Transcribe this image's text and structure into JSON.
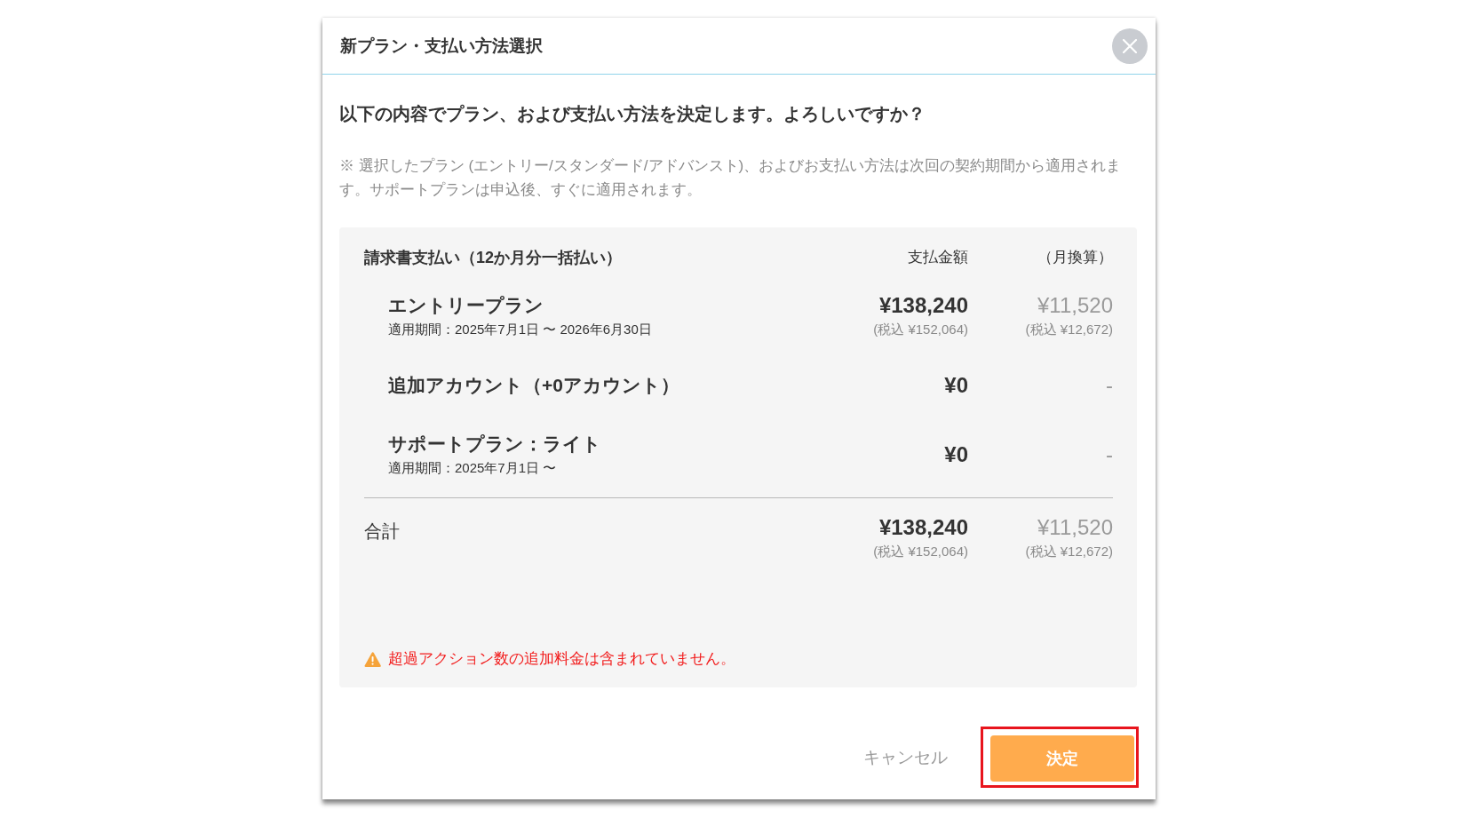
{
  "dialog": {
    "title": "新プラン・支払い方法選択",
    "question": "以下の内容でプラン、および支払い方法を決定します。よろしいですか？",
    "note": "※ 選択したプラン (エントリー/スタンダード/アドバンスト)、およびお支払い方法は次回の契約期間から適用されます。サポートプランは申込後、すぐに適用されます。"
  },
  "summary": {
    "heading": "請求書支払い（12か月分一括払い）",
    "columns": [
      "支払金額",
      "（月換算）"
    ],
    "items": [
      {
        "name": "エントリープラン",
        "period": "適用期間：2025年7月1日 〜 2026年6月30日",
        "amount": "¥138,240",
        "amount_tax": "(税込 ¥152,064)",
        "monthly": "¥11,520",
        "monthly_tax": "(税込 ¥12,672)"
      },
      {
        "name": "追加アカウント（+0アカウント）",
        "amount": "¥0",
        "monthly": "-"
      },
      {
        "name": "サポートプラン：ライト",
        "period": "適用期間：2025年7月1日 〜",
        "amount": "¥0",
        "monthly": "-"
      }
    ],
    "total": {
      "label": "合計",
      "amount": "¥138,240",
      "amount_tax": "(税込 ¥152,064)",
      "monthly": "¥11,520",
      "monthly_tax": "(税込 ¥12,672)"
    },
    "warning": "超過アクション数の追加料金は含まれていません。"
  },
  "buttons": [
    {
      "label": "キャンセル",
      "kind": "link",
      "highlighted": false
    },
    {
      "label": "決定",
      "kind": "primary",
      "highlighted": true
    }
  ]
}
